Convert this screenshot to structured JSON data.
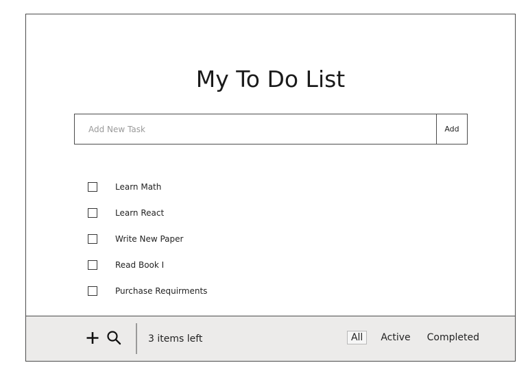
{
  "app": {
    "title": "My To Do List"
  },
  "add_task": {
    "placeholder": "Add New Task",
    "button_label": "Add"
  },
  "tasks": [
    {
      "label": "Learn Math",
      "checked": false
    },
    {
      "label": "Learn React",
      "checked": false
    },
    {
      "label": "Write New Paper",
      "checked": false
    },
    {
      "label": "Read Book I",
      "checked": false
    },
    {
      "label": "Purchase Requirments",
      "checked": false
    }
  ],
  "footer": {
    "add_icon": "plus-icon",
    "search_icon": "search-icon",
    "items_left": "3 items left",
    "filters": [
      {
        "label": "All",
        "selected": true
      },
      {
        "label": "Active",
        "selected": false
      },
      {
        "label": "Completed",
        "selected": false
      }
    ]
  }
}
